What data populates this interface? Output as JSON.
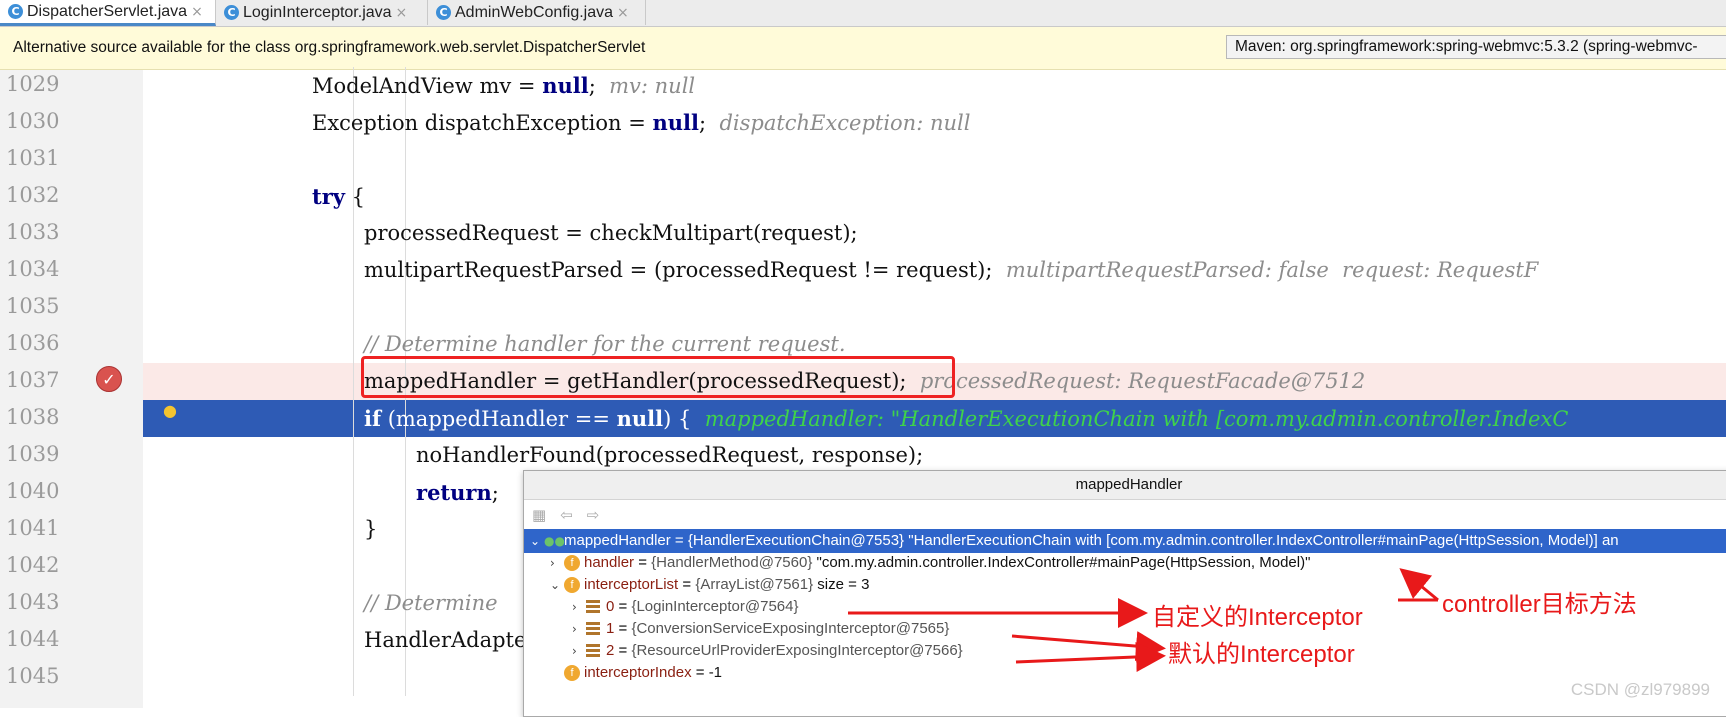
{
  "tabs": [
    {
      "label": "DispatcherServlet.java",
      "icon": "class-icon",
      "active": true
    },
    {
      "label": "LoginInterceptor.java",
      "icon": "class-icon",
      "active": false
    },
    {
      "label": "AdminWebConfig.java",
      "icon": "class-icon",
      "active": false
    }
  ],
  "banner": {
    "text": "Alternative source available for the class org.springframework.web.servlet.DispatcherServlet",
    "maven": "Maven: org.springframework:spring-webmvc:5.3.2 (spring-webmvc-"
  },
  "lines": [
    {
      "num": "1029",
      "code": "ModelAndView mv = ",
      "kw": "null",
      "rest": ";",
      "hint": "mv: null"
    },
    {
      "num": "1030",
      "code": "Exception dispatchException = ",
      "kw": "null",
      "rest": ";",
      "hint": "dispatchException: null"
    },
    {
      "num": "1031"
    },
    {
      "num": "1032",
      "kw_first": "try",
      "rest": " {"
    },
    {
      "num": "1033",
      "code": "processedRequest = checkMultipart(request);"
    },
    {
      "num": "1034",
      "code": "multipartRequestParsed = (processedRequest != request);",
      "hint": "multipartRequestParsed: false  request: RequestF"
    },
    {
      "num": "1035"
    },
    {
      "num": "1036",
      "comment": "// Determine handler for the current request."
    },
    {
      "num": "1037",
      "code": "mappedHandler = getHandler(processedRequest);",
      "hint": "processedRequest: RequestFacade@7512"
    },
    {
      "num": "1038",
      "kw_first": "if",
      "rest": " (mappedHandler == ",
      "kw2": "null",
      "rest2": ") {",
      "hint": "mappedHandler: \"HandlerExecutionChain with [com.my.admin.controller.IndexC"
    },
    {
      "num": "1039",
      "code": "noHandlerFound(processedRequest, response);"
    },
    {
      "num": "1040",
      "kw_first": "return",
      "rest": ";"
    },
    {
      "num": "1041",
      "code": "}"
    },
    {
      "num": "1042"
    },
    {
      "num": "1043",
      "comment": "// Determine"
    },
    {
      "num": "1044",
      "code": "HandlerAdapte"
    },
    {
      "num": "1045"
    }
  ],
  "popup": {
    "title": "mappedHandler",
    "rows": [
      {
        "name": "mappedHandler",
        "type": "{HandlerExecutionChain@7553}",
        "value": "\"HandlerExecutionChain with [com.my.admin.controller.IndexController#mainPage(HttpSession, Model)] an"
      },
      {
        "name": "handler",
        "type": "{HandlerMethod@7560}",
        "value": "\"com.my.admin.controller.IndexController#mainPage(HttpSession, Model)\""
      },
      {
        "name": "interceptorList",
        "type": "{ArrayList@7561}",
        "value": "size = 3"
      },
      {
        "name": "0",
        "type": "{LoginInterceptor@7564}",
        "value": ""
      },
      {
        "name": "1",
        "type": "{ConversionServiceExposingInterceptor@7565}",
        "value": ""
      },
      {
        "name": "2",
        "type": "{ResourceUrlProviderExposingInterceptor@7566}",
        "value": ""
      },
      {
        "name": "interceptorIndex",
        "type": "",
        "value": "-1"
      }
    ]
  },
  "annotations": {
    "custom": "自定义的Interceptor",
    "default": "默认的Interceptor",
    "controller": "controller目标方法"
  },
  "watermark": "CSDN @zl979899",
  "colors": {
    "selection": "#2e5bb5",
    "breakpoint_line": "#fbe9e7",
    "annotation": "#e8191a",
    "banner": "#fffbd9"
  }
}
